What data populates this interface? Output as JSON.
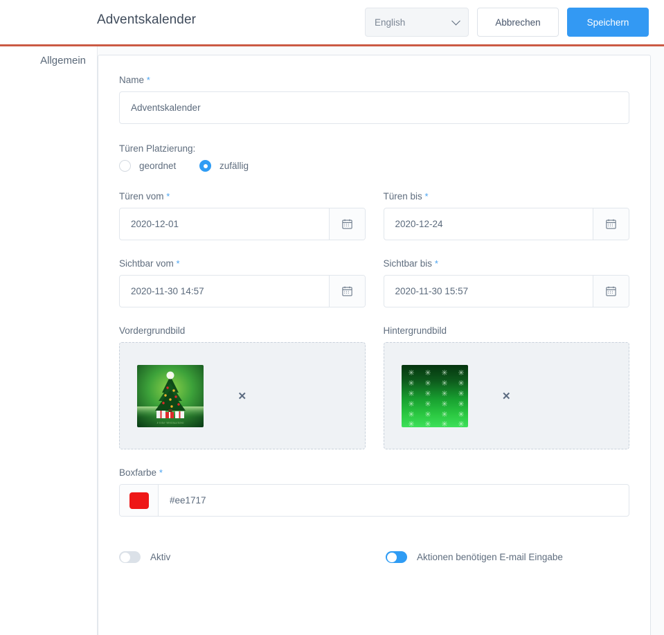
{
  "header": {
    "title": "Adventskalender",
    "language_value": "English",
    "cancel_label": "Abbrechen",
    "save_label": "Speichern"
  },
  "sidebar": {
    "items": [
      {
        "label": "Allgemein"
      }
    ]
  },
  "form": {
    "name": {
      "label": "Name",
      "required_mark": "*",
      "value": "Adventskalender"
    },
    "placement": {
      "label": "Türen Platzierung:",
      "options": [
        {
          "label": "geordnet",
          "selected": false
        },
        {
          "label": "zufällig",
          "selected": true
        }
      ]
    },
    "doors_from": {
      "label": "Türen vom",
      "required_mark": "*",
      "value": "2020-12-01",
      "icon": "calendar-icon"
    },
    "doors_to": {
      "label": "Türen bis",
      "required_mark": "*",
      "value": "2020-12-24",
      "icon": "calendar-icon"
    },
    "visible_from": {
      "label": "Sichtbar vom",
      "required_mark": "*",
      "value": "2020-11-30 14:57",
      "icon": "calendar-icon"
    },
    "visible_to": {
      "label": "Sichtbar bis",
      "required_mark": "*",
      "value": "2020-11-30 15:57",
      "icon": "calendar-icon"
    },
    "foreground_image": {
      "label": "Vordergrundbild",
      "remove_icon": "close-icon",
      "thumbnail_alt": "christmas-tree-with-presents"
    },
    "background_image": {
      "label": "Hintergrundbild",
      "remove_icon": "close-icon",
      "thumbnail_alt": "green-snowflake-gradient"
    },
    "box_color": {
      "label": "Boxfarbe",
      "required_mark": "*",
      "value": "#ee1717",
      "swatch_color": "#ee1717"
    },
    "toggles": [
      {
        "label": "Aktiv",
        "on": false
      },
      {
        "label": "Aktionen benötigen E-mail Eingabe",
        "on": true
      }
    ]
  },
  "colors": {
    "accent": "#3399f3",
    "rule": "#cb5a44",
    "box_color": "#ee1717"
  }
}
